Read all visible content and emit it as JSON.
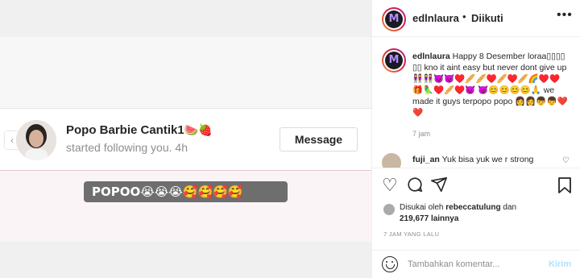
{
  "media": {
    "notification": {
      "username": "Popo Barbie Cantik1",
      "username_emoji": "🍉🍓",
      "action": "started following you.",
      "time": "4h",
      "message_button": "Message"
    },
    "sticker_text": "POPOO😭😭😭🥰🥰🥰🥰"
  },
  "header": {
    "username": "edlnlaura",
    "separator": "•",
    "follow_status": "Diikuti",
    "more_icon": "more-dots-icon",
    "more_glyph": "•••"
  },
  "caption": {
    "username": "edlnlaura",
    "text": "Happy 8 Desember loraa▯▯▯▯ ▯▯ kno it aint easy but never dont give up👭👭😈😈♥️🥖🥖♥️🥖♥️🥖🌈♥️♥️🎁🦜♥️🥖♥️😈 😈😊😊😊😊🙏 we made it guys terpopo popo 👩👩👦👦❤️❤️",
    "time": "7 jam"
  },
  "comment": {
    "username": "fuji_an",
    "text": "Yuk bisa yuk we r strong"
  },
  "actions": {
    "like_icon": "heart-icon",
    "comment_icon": "comment-icon",
    "share_icon": "share-icon",
    "save_icon": "bookmark-icon"
  },
  "likes": {
    "prefix": "Disukai oleh",
    "user": "rebeccatulung",
    "joiner": "dan",
    "count": "219,677",
    "suffix": "lainnya"
  },
  "posted": "7 JAM YANG LALU",
  "add_comment": {
    "placeholder": "Tambahkan komentar...",
    "send_label": "Kirim"
  },
  "colors": {
    "send_disabled": "#b2dffc",
    "muted_text": "#8e8e8e",
    "ring_gradient": [
      "#f09433",
      "#dc2743",
      "#bc1888"
    ]
  }
}
